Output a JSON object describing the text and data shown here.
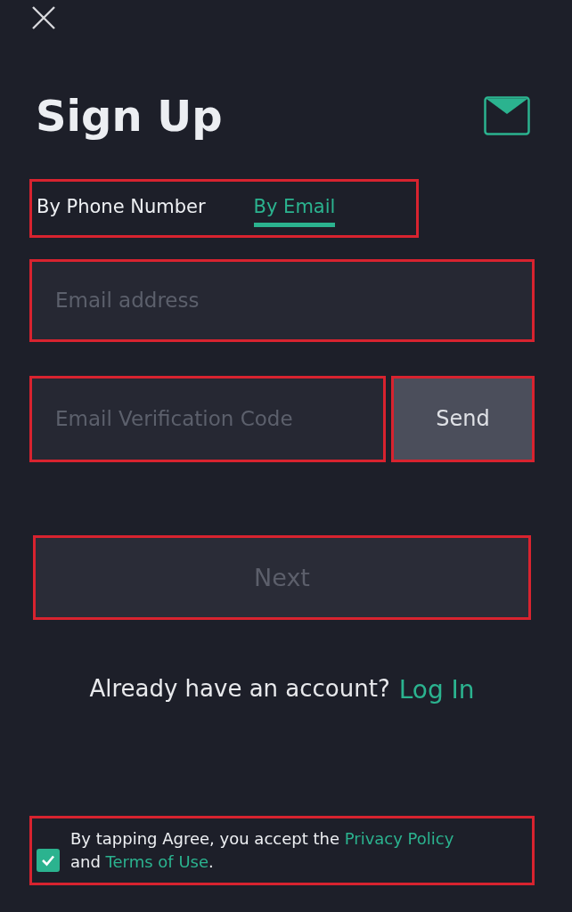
{
  "title": "Sign Up",
  "tabs": [
    {
      "label": "By Phone Number",
      "selected": false
    },
    {
      "label": "By Email",
      "selected": true
    }
  ],
  "email_field": {
    "placeholder": "Email address"
  },
  "code_field": {
    "placeholder": "Email Verification Code"
  },
  "send_button": "Send",
  "next_button": {
    "label": "Next",
    "disabled": true
  },
  "login_prompt": {
    "text": "Already have an account?",
    "link": "Log In"
  },
  "agreement": {
    "checked": true,
    "text_before": "By tapping Agree, you accept the",
    "privacy_link": "Privacy Policy",
    "text_and": "and",
    "terms_link": "Terms of Use",
    "text_end": "."
  }
}
